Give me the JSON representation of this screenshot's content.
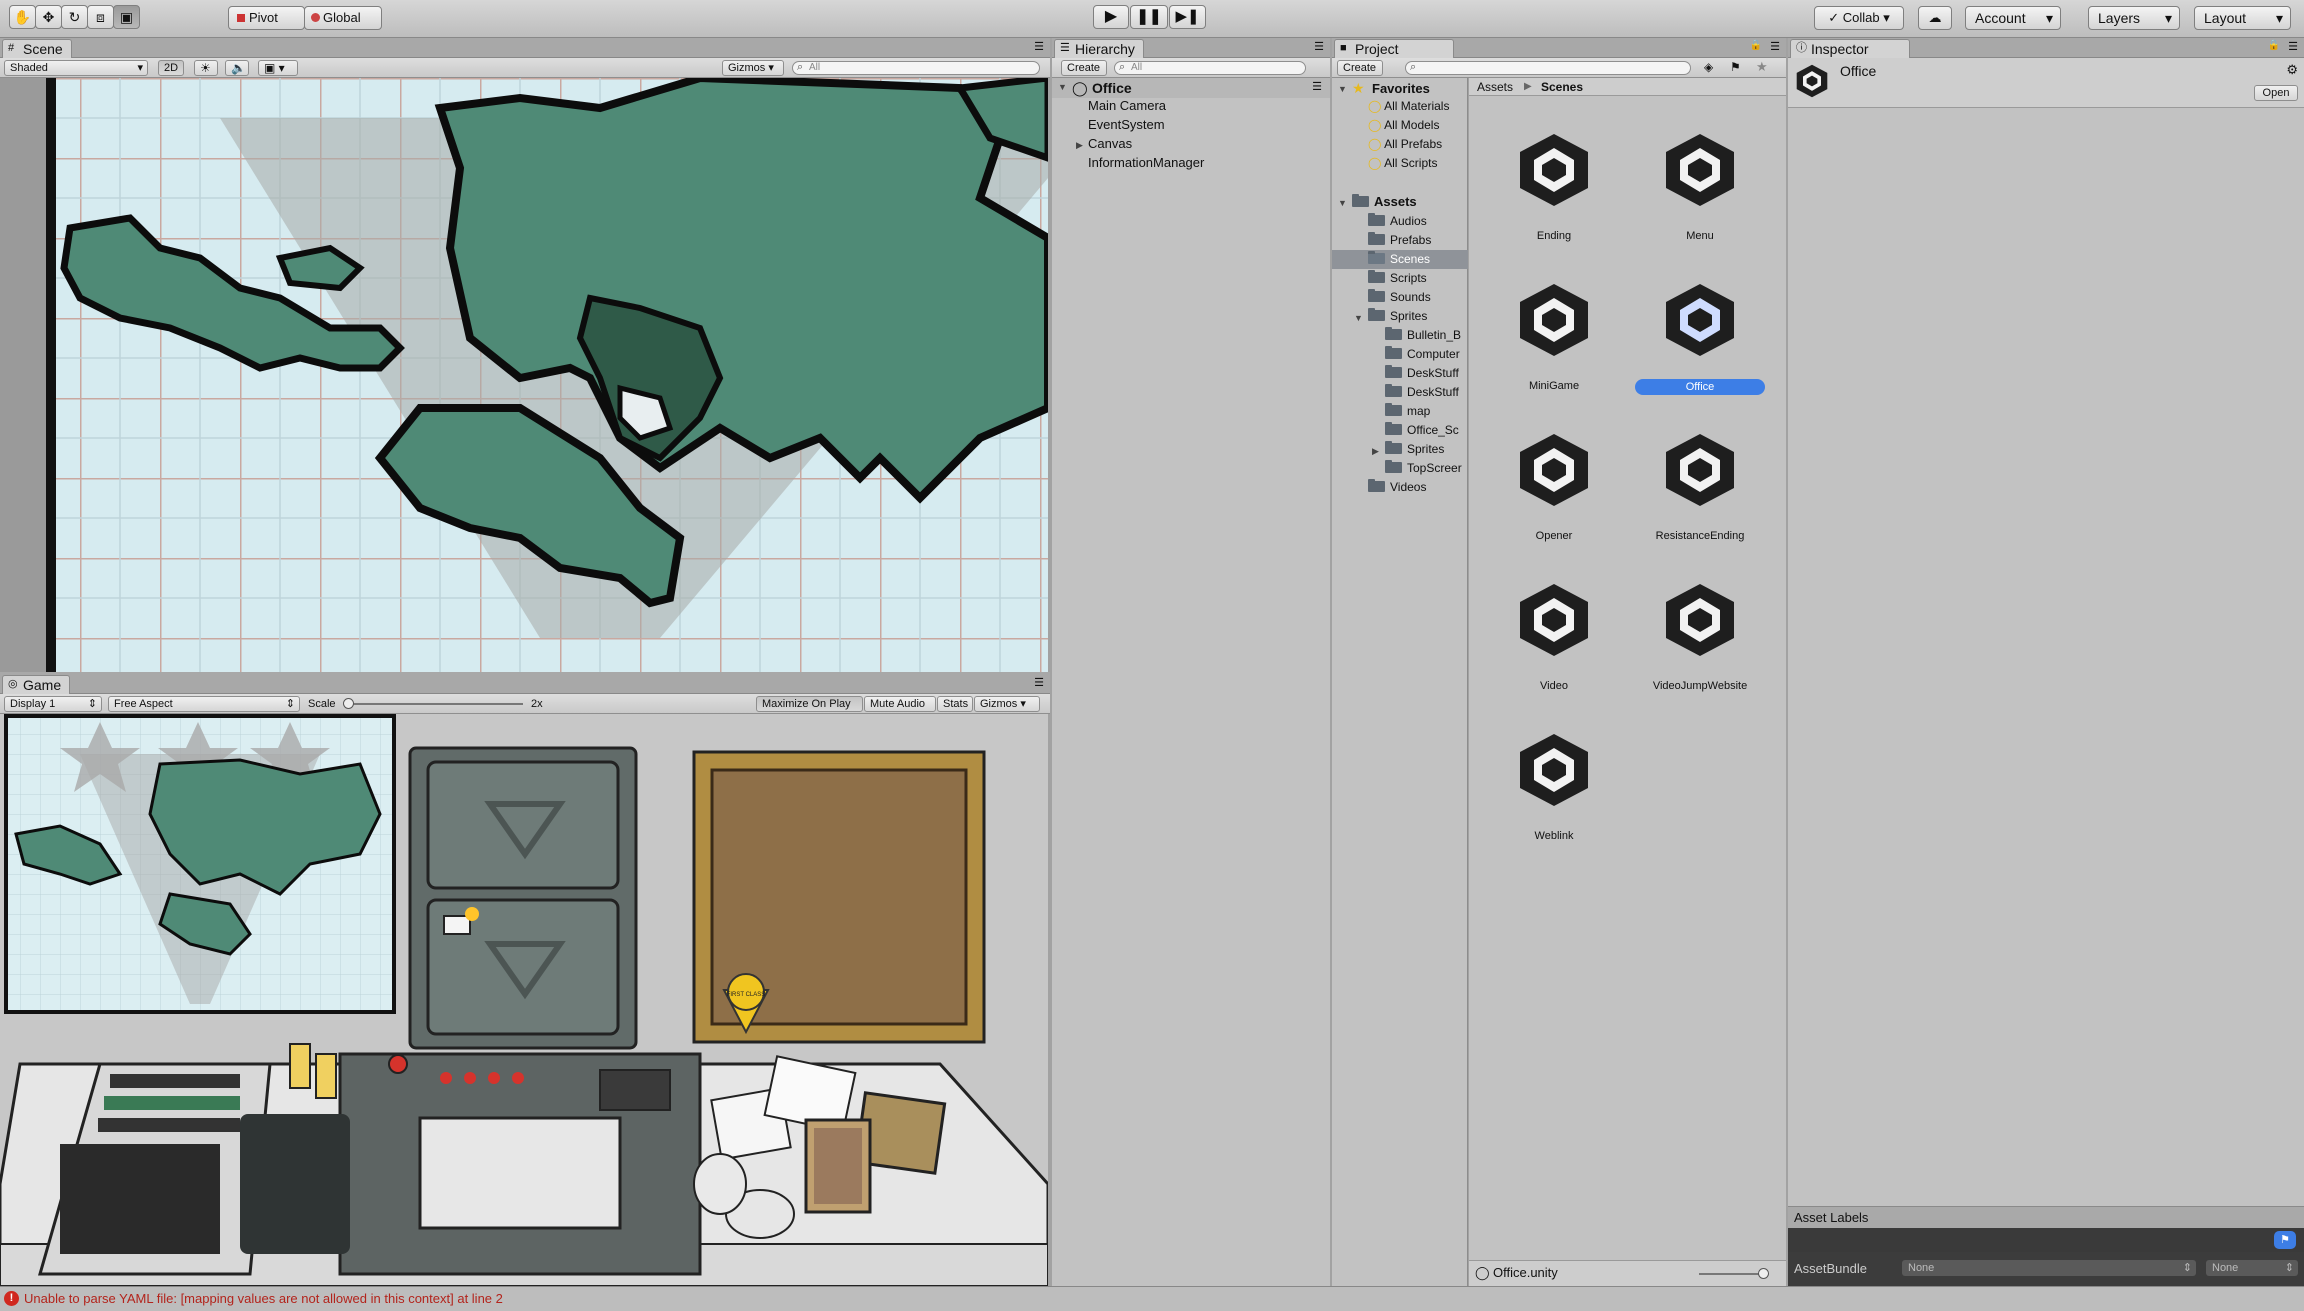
{
  "toolbar": {
    "tools": [
      "hand-tool",
      "move-tool",
      "rotate-tool",
      "scale-tool",
      "rect-tool"
    ],
    "pivot": "Pivot",
    "global": "Global",
    "collab": "Collab",
    "account": "Account",
    "layers": "Layers",
    "layout": "Layout"
  },
  "scene": {
    "tab": "Scene",
    "shading": "Shaded",
    "mode2d": "2D",
    "gizmos": "Gizmos",
    "search_placeholder": "All"
  },
  "game": {
    "tab": "Game",
    "display": "Display 1",
    "aspect": "Free Aspect",
    "scale_label": "Scale",
    "scale_value": "2x",
    "maximize": "Maximize On Play",
    "mute": "Mute Audio",
    "stats": "Stats",
    "gizmos": "Gizmos",
    "badge_text": "FIRST CLASS"
  },
  "hierarchy": {
    "tab": "Hierarchy",
    "create": "Create",
    "search_placeholder": "All",
    "scene_name": "Office",
    "items": [
      "Main Camera",
      "EventSystem",
      "Canvas",
      "InformationManager"
    ]
  },
  "project": {
    "tab": "Project",
    "create": "Create",
    "favorites_label": "Favorites",
    "favorites": [
      "All Materials",
      "All Models",
      "All Prefabs",
      "All Scripts"
    ],
    "assets_label": "Assets",
    "folders": [
      "Audios",
      "Prefabs",
      "Scenes",
      "Scripts",
      "Sounds",
      "Sprites"
    ],
    "sprite_folders": [
      "Bulletin_B",
      "Computer",
      "DeskStuff",
      "DeskStuff",
      "map",
      "Office_Sc",
      "Sprites",
      "TopScreer"
    ],
    "videos": "Videos",
    "breadcrumb": [
      "Assets",
      "Scenes"
    ],
    "scenes": [
      "Ending",
      "Menu",
      "MiniGame",
      "Office",
      "Opener",
      "ResistanceEnding",
      "Video",
      "VideoJumpWebsite",
      "Weblink"
    ],
    "selected_scene": "Office",
    "footer_file": "Office.unity"
  },
  "inspector": {
    "tab": "Inspector",
    "title": "Office",
    "open": "Open",
    "asset_labels": "Asset Labels",
    "assetbundle_label": "AssetBundle",
    "assetbundle_value": "None",
    "variant_value": "None"
  },
  "status": {
    "message": "Unable to parse YAML file: [mapping values are not allowed in this context] at line 2"
  },
  "colors": {
    "selection": "#3d7ee6",
    "map_land": "#4f8a76",
    "map_water": "#d4eaf0",
    "error": "#d0281f"
  }
}
